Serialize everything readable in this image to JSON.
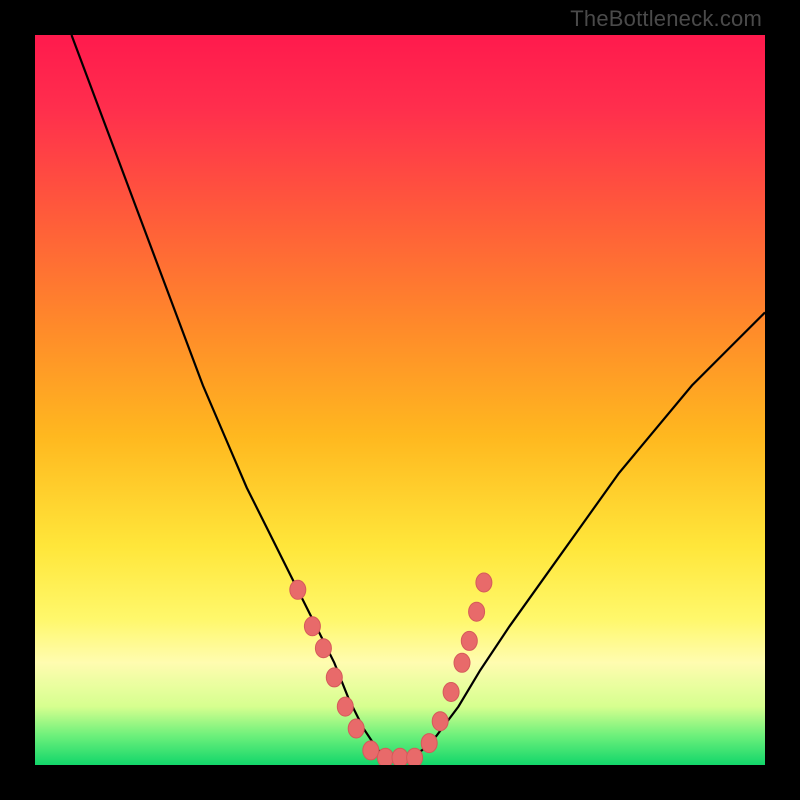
{
  "attribution": "TheBottleneck.com",
  "colors": {
    "background": "#000000",
    "dot": "#e86a6a",
    "curve": "#000000",
    "gradient_top": "#ff1a4d",
    "gradient_bottom": "#12d66a"
  },
  "chart_data": {
    "type": "line",
    "title": "",
    "xlabel": "",
    "ylabel": "",
    "xlim": [
      0,
      100
    ],
    "ylim": [
      0,
      100
    ],
    "note": "Axes unlabeled; values are pixel-normalized estimates (0–100 each axis, origin bottom-left). Curve is a bottleneck V-shape.",
    "series": [
      {
        "name": "curve",
        "x": [
          5,
          8,
          11,
          14,
          17,
          20,
          23,
          26,
          29,
          32,
          35,
          38,
          41,
          43,
          45,
          47,
          49,
          51,
          53,
          55,
          58,
          61,
          65,
          70,
          75,
          80,
          85,
          90,
          95,
          100
        ],
        "y": [
          100,
          92,
          84,
          76,
          68,
          60,
          52,
          45,
          38,
          32,
          26,
          20,
          14,
          9,
          5,
          2,
          1,
          1,
          2,
          4,
          8,
          13,
          19,
          26,
          33,
          40,
          46,
          52,
          57,
          62
        ]
      }
    ],
    "markers": {
      "name": "highlight-dots",
      "note": "Clustered markers near valley floor and lower walls",
      "x": [
        36,
        38,
        39.5,
        41,
        42.5,
        44,
        46,
        48,
        50,
        52,
        54,
        55.5,
        57,
        58.5,
        59.5,
        60.5,
        61.5
      ],
      "y": [
        24,
        19,
        16,
        12,
        8,
        5,
        2,
        1,
        1,
        1,
        3,
        6,
        10,
        14,
        17,
        21,
        25
      ]
    }
  }
}
